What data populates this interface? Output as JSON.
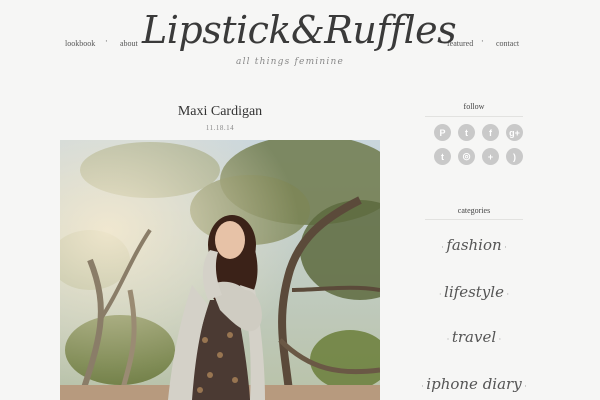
{
  "header": {
    "logo": "Lipstick&Ruffles",
    "tagline": "all things feminine",
    "nav": [
      "lookbook",
      "about",
      "featured",
      "contact"
    ]
  },
  "post": {
    "title": "Maxi Cardigan",
    "date": "11.18.14"
  },
  "sidebar": {
    "follow_title": "follow",
    "social": [
      {
        "icon": "pinterest-icon",
        "glyph": "P"
      },
      {
        "icon": "twitter-icon",
        "glyph": "t"
      },
      {
        "icon": "facebook-icon",
        "glyph": "f"
      },
      {
        "icon": "google-plus-icon",
        "glyph": "g+"
      },
      {
        "icon": "tumblr-icon",
        "glyph": "t"
      },
      {
        "icon": "instagram-icon",
        "glyph": "◎"
      },
      {
        "icon": "bloglovin-icon",
        "glyph": "+"
      },
      {
        "icon": "rss-icon",
        "glyph": ")"
      }
    ],
    "categories_title": "categories",
    "categories": [
      "fashion",
      "lifestyle",
      "travel",
      "iphone diary"
    ]
  }
}
